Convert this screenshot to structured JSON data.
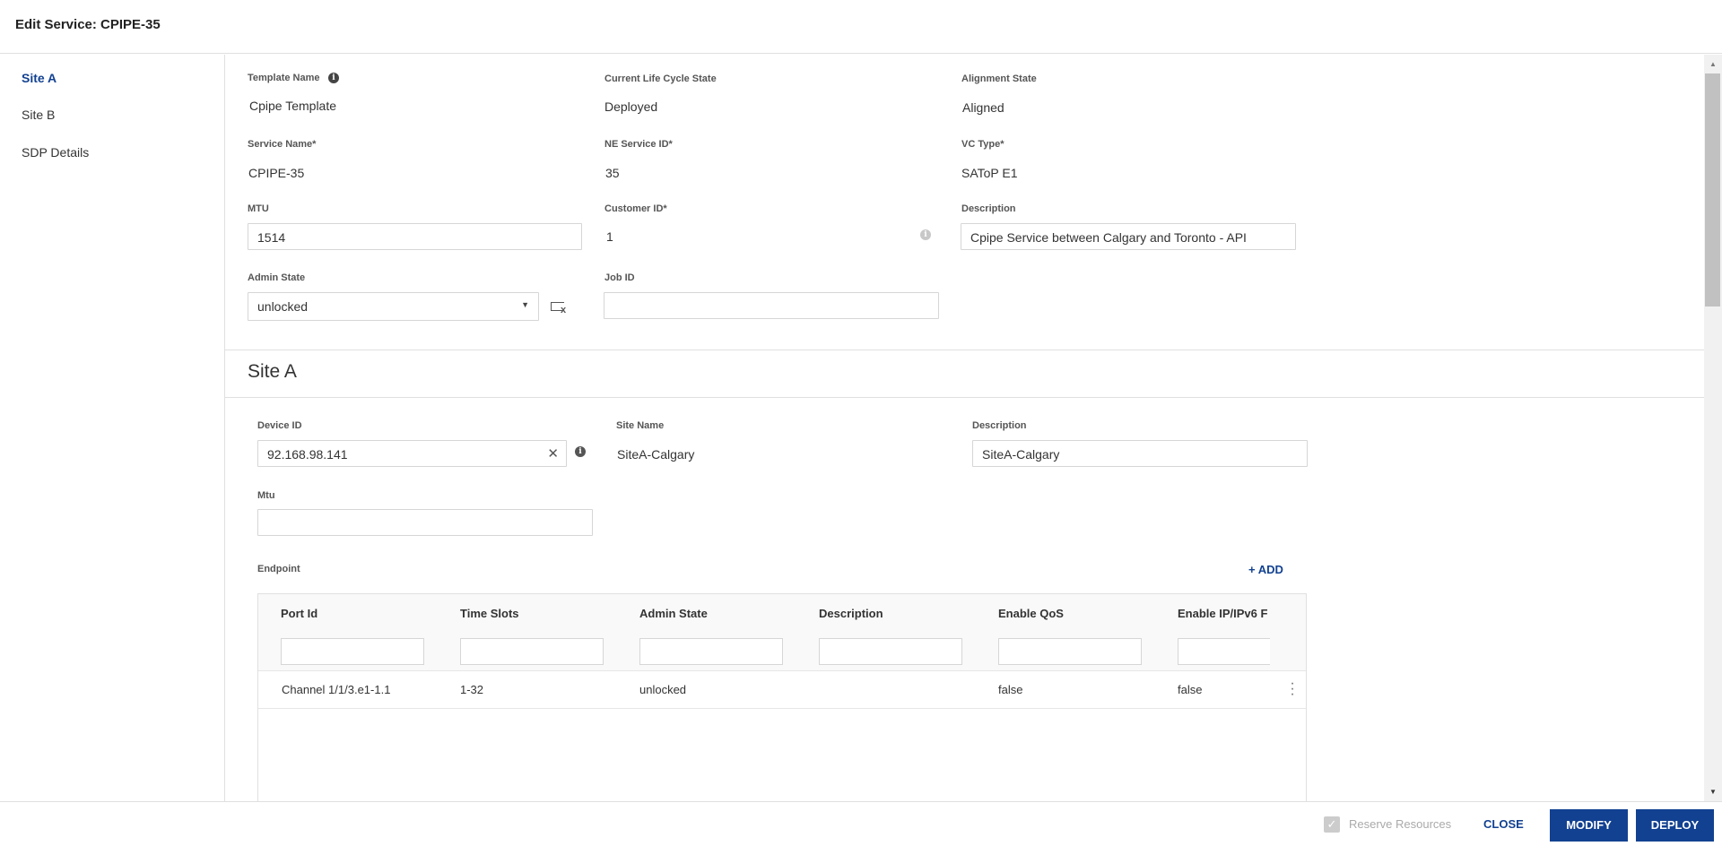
{
  "header": {
    "title": "Edit Service: CPIPE-35"
  },
  "sidebar": {
    "items": [
      {
        "label": "Site A",
        "active": true
      },
      {
        "label": "Site B"
      },
      {
        "label": "SDP Details"
      }
    ]
  },
  "general": {
    "template_name": {
      "label": "Template Name",
      "value": "Cpipe Template"
    },
    "lifecycle": {
      "label": "Current Life Cycle State",
      "value": "Deployed"
    },
    "alignment": {
      "label": "Alignment State",
      "value": "Aligned"
    },
    "service_name": {
      "label": "Service Name*",
      "value": "CPIPE-35"
    },
    "ne_service_id": {
      "label": "NE Service ID*",
      "value": "35"
    },
    "vc_type": {
      "label": "VC Type*",
      "value": "SAToP E1"
    },
    "mtu": {
      "label": "MTU",
      "value": "1514"
    },
    "customer_id": {
      "label": "Customer ID*",
      "value": "1"
    },
    "description": {
      "label": "Description",
      "value": "Cpipe Service between Calgary and Toronto - API"
    },
    "admin_state": {
      "label": "Admin State",
      "value": "unlocked"
    },
    "job_id": {
      "label": "Job ID",
      "value": ""
    }
  },
  "site_a": {
    "title": "Site A",
    "device_id": {
      "label": "Device ID",
      "value": "92.168.98.141"
    },
    "site_name": {
      "label": "Site Name",
      "value": "SiteA-Calgary"
    },
    "description": {
      "label": "Description",
      "value": "SiteA-Calgary"
    },
    "mtu": {
      "label": "Mtu",
      "value": ""
    },
    "endpoint": {
      "label": "Endpoint",
      "add_label": "+ ADD"
    },
    "table": {
      "columns": [
        "Port Id",
        "Time Slots",
        "Admin State",
        "Description",
        "Enable QoS",
        "Enable IP/IPv6 F"
      ],
      "rows": [
        [
          "Channel 1/1/3.e1-1.1",
          "1-32",
          "unlocked",
          "",
          "false",
          "false"
        ]
      ]
    }
  },
  "footer": {
    "reserve_resources": "Reserve Resources",
    "reserve_checked": true,
    "close": "CLOSE",
    "modify": "MODIFY",
    "deploy": "DEPLOY"
  },
  "colors": {
    "primary": "#124191"
  }
}
